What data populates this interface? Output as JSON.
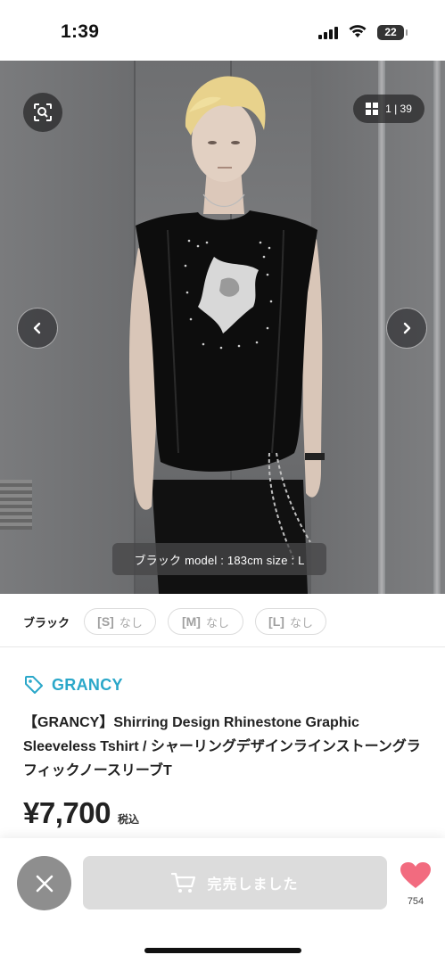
{
  "status_bar": {
    "time": "1:39",
    "battery": "22",
    "icons": [
      "signal-icon",
      "wifi-icon",
      "battery-icon"
    ]
  },
  "gallery": {
    "counter_current": "1",
    "counter_total": "39",
    "counter_text": "1 | 39",
    "caption": "ブラック model : 183cm size : L",
    "icons": {
      "scan": "scan-icon",
      "grid": "grid-icon",
      "prev": "chevron-left-icon",
      "next": "chevron-right-icon"
    }
  },
  "variants": {
    "color": "ブラック",
    "sizes": [
      {
        "size": "[S]",
        "stock": "なし"
      },
      {
        "size": "[M]",
        "stock": "なし"
      },
      {
        "size": "[L]",
        "stock": "なし"
      }
    ]
  },
  "product": {
    "brand": "GRANCY",
    "title": "【GRANCY】Shirring Design Rhinestone Graphic Sleeveless Tshirt / シャーリングデザインラインストーングラフィックノースリーブT",
    "price": "¥7,700",
    "tax_label": "税込"
  },
  "actions": {
    "sold_out_label": "完売しました",
    "favorite_count": "754"
  },
  "colors": {
    "brand_accent": "#2aa7c9",
    "favorite_heart": "#f26b7f",
    "disabled_button": "#dcdcdc"
  }
}
